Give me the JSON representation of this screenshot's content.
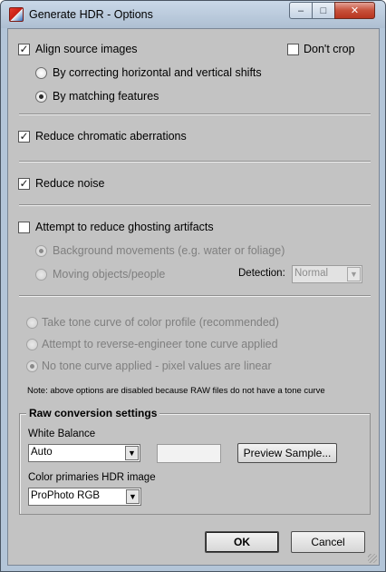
{
  "window": {
    "title": "Generate HDR - Options",
    "minimize_glyph": "–",
    "maximize_glyph": "□",
    "close_glyph": "✕"
  },
  "alignment": {
    "align_label": "Align source images",
    "align_checked": true,
    "dont_crop_label": "Don't crop",
    "dont_crop_checked": false,
    "option_shifts": "By correcting horizontal and vertical shifts",
    "option_features": "By matching features",
    "selected": "By matching features"
  },
  "chromatic": {
    "label": "Reduce chromatic aberrations",
    "checked": true
  },
  "noise": {
    "label": "Reduce noise",
    "checked": true
  },
  "ghosting": {
    "label": "Attempt to reduce ghosting artifacts",
    "checked": false,
    "option_background": "Background movements (e.g. water or foliage)",
    "option_moving": "Moving objects/people",
    "selected": "Background movements (e.g. water or foliage)",
    "detection_label": "Detection:",
    "detection_value": "Normal"
  },
  "tone_curve": {
    "option_color_profile": "Take tone curve of color profile (recommended)",
    "option_reverse_engineer": "Attempt to reverse-engineer tone curve applied",
    "option_linear": "No tone curve applied - pixel values are linear",
    "selected": "No tone curve applied - pixel values are linear",
    "note": "Note: above options are disabled because RAW files do not have a tone curve"
  },
  "raw_settings": {
    "group_title": "Raw conversion settings",
    "white_balance_label": "White Balance",
    "white_balance_value": "Auto",
    "white_balance_input": "",
    "preview_button": "Preview Sample...",
    "color_primaries_label": "Color primaries HDR image",
    "color_primaries_value": "ProPhoto RGB"
  },
  "footer": {
    "ok_label": "OK",
    "cancel_label": "Cancel"
  },
  "check_glyph": "✓",
  "dropdown_glyph": "▼"
}
